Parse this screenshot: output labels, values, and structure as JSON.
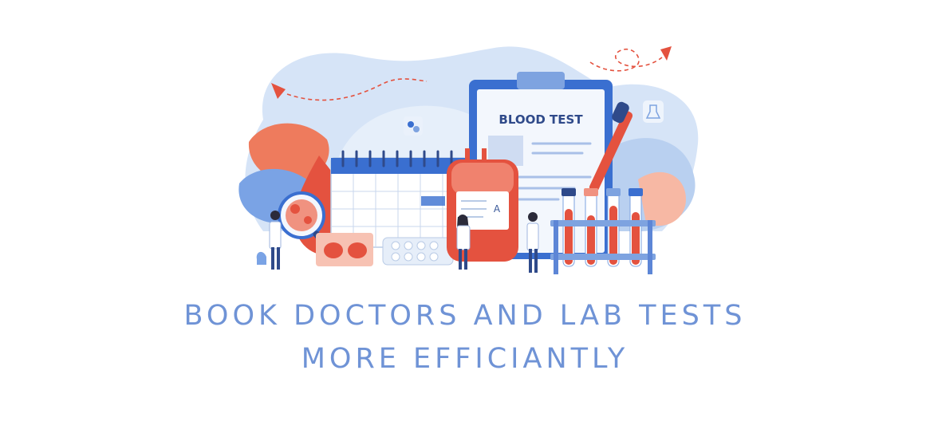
{
  "clipboard": {
    "title": "BLOOD TEST"
  },
  "blood_bag": {
    "label_letter": "A"
  },
  "headline": {
    "line1": "BOOK DOCTORS AND LAB TESTS",
    "line2": "MORE EFFICIANTLY"
  },
  "colors": {
    "headline_text": "#6f93d6",
    "primary_blue": "#3a6fd0",
    "light_blue": "#cfe0f7",
    "accent_red": "#e4523f",
    "accent_orange": "#ee7b5d"
  }
}
